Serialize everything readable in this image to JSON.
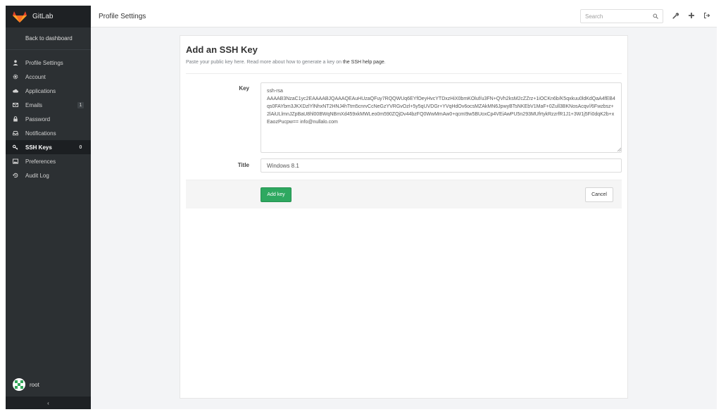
{
  "app": {
    "name": "GitLab",
    "colors": {
      "sidebar": "#2c3033",
      "accent_green": "#2ea860",
      "logo_orange": "#e2432a"
    }
  },
  "sidebar": {
    "back_label": "Back to dashboard",
    "items": [
      {
        "label": "Profile Settings",
        "icon": "user-icon",
        "count": ""
      },
      {
        "label": "Account",
        "icon": "gear-icon",
        "count": ""
      },
      {
        "label": "Applications",
        "icon": "cloud-icon",
        "count": ""
      },
      {
        "label": "Emails",
        "icon": "envelope-icon",
        "count": "1"
      },
      {
        "label": "Password",
        "icon": "lock-icon",
        "count": ""
      },
      {
        "label": "Notifications",
        "icon": "inbox-icon",
        "count": ""
      },
      {
        "label": "SSH Keys",
        "icon": "key-icon",
        "count": "0",
        "active": true
      },
      {
        "label": "Preferences",
        "icon": "image-icon",
        "count": ""
      },
      {
        "label": "Audit Log",
        "icon": "history-icon",
        "count": ""
      }
    ],
    "user": "root",
    "collapse_glyph": "‹"
  },
  "header": {
    "title": "Profile Settings",
    "search_placeholder": "Search"
  },
  "form": {
    "heading": "Add an SSH Key",
    "subtitle_prefix": "Paste your public key here. Read more about how to generate a key on ",
    "subtitle_link": "the SSH help page",
    "subtitle_suffix": ".",
    "key_label": "Key",
    "key_value": "ssh-rsa\nAAAAB3NzaC1yc2EAAAABJQAAAQEAuHUzaQFuy7RQQWUq6EYfOeyHvcYTDxzHiX0bmKOluf/u3FN+QVh2ksM2cZZrz+1iOCKn6b/K5qxkuu0ldKdQaA4fEB4qs0FAYbm3JKXDzlYlNhxNT2HNJ4hTtm5cnrvCcNeGzYVRGvOzl+5y5qUVDGr+YVqHdOv6ocsMZAkMN6JpwyBTsNKEbV1MaF+0Zull3BKNosAcqv//6Fwzbsz+2lAiULlmnJZpBaU8hl00BWqNBmXd459xkMWLeo0m590ZQjDv44bzFQ0WwMmAw0+qcmI9w5BUoxCp4VEiAwPU5n293MUfrtykRzzrfR1J1+3W1j5Fi0dqK2b+xEaozPucpw== info@nullalo.com",
    "title_label": "Title",
    "title_value": "Windows 8.1",
    "add_label": "Add key",
    "cancel_label": "Cancel"
  }
}
